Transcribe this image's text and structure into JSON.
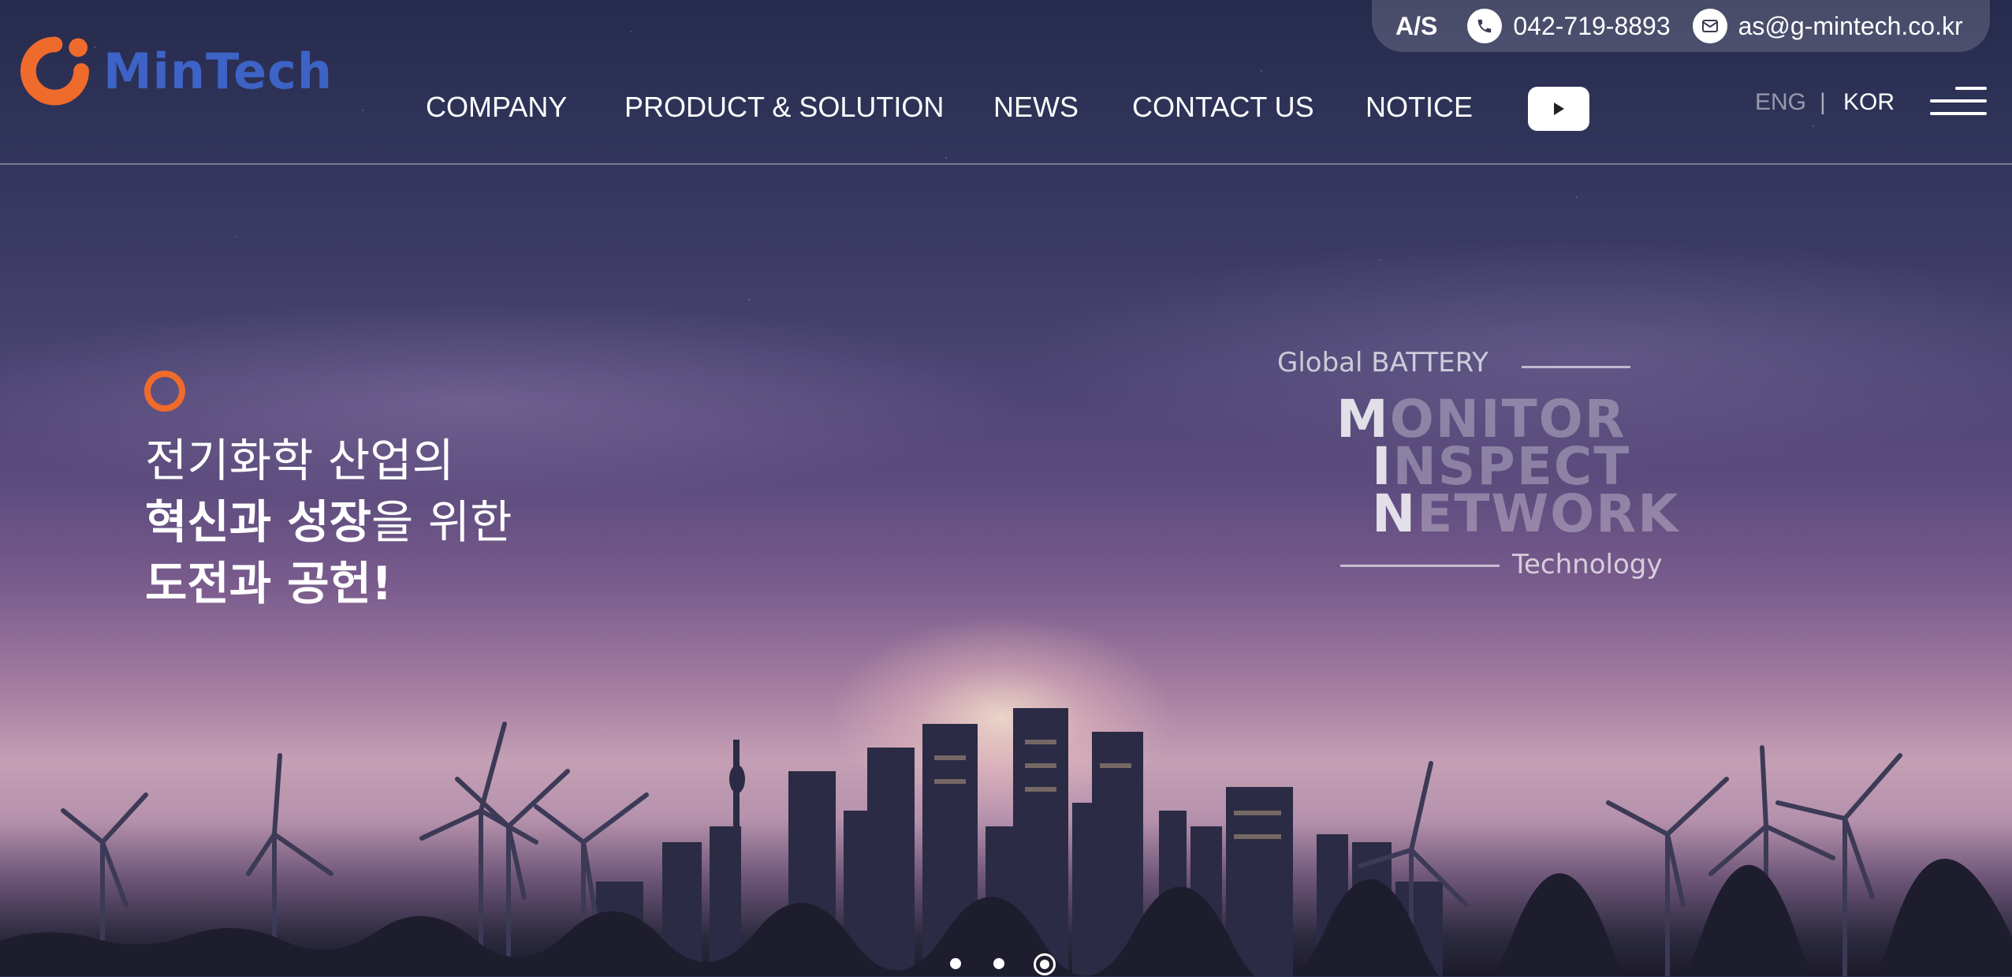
{
  "brand": {
    "name": "MinTech",
    "logo_color": "#ef6b2b",
    "text_color": "#3d63c6"
  },
  "topbar": {
    "as_label": "A/S",
    "phone_icon": "phone-icon",
    "phone": "042-719-8893",
    "mail_icon": "mail-icon",
    "email": "as@g-mintech.co.kr"
  },
  "nav": {
    "items": [
      {
        "label": "COMPANY"
      },
      {
        "label": "PRODUCT & SOLUTION"
      },
      {
        "label": "NEWS"
      },
      {
        "label": "CONTACT US"
      },
      {
        "label": "NOTICE"
      }
    ],
    "youtube_icon": "youtube-play-icon"
  },
  "lang": {
    "eng": "ENG",
    "separator": "|",
    "kor": "KOR",
    "active": "KOR"
  },
  "hero": {
    "line1": "전기화학 산업의",
    "line2_bold": "혁신과 성장",
    "line2_rest": "을 위한",
    "line3": "도전과 공헌!",
    "accent": "#ef6b2b"
  },
  "tagline": {
    "top": "Global BATTERY",
    "words": [
      {
        "first": "M",
        "rest": "ONITOR"
      },
      {
        "first": "I",
        "rest": "NSPECT"
      },
      {
        "first": "N",
        "rest": "ETWORK"
      }
    ],
    "bottom": "Technology"
  },
  "slider": {
    "count": 3,
    "active_index": 3
  }
}
